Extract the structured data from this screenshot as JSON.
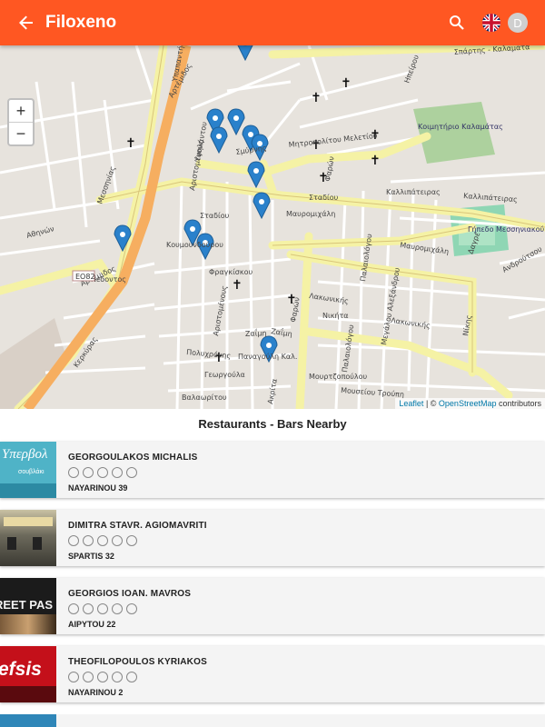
{
  "app": {
    "title": "Filoxeno",
    "avatar_letter": "D",
    "accent": "#ff5722"
  },
  "map": {
    "zoom_in": "+",
    "zoom_out": "−",
    "attribution": {
      "leaflet": "Leaflet",
      "sep": " | © ",
      "osm": "OpenStreetMap",
      "suffix": " contributors"
    },
    "labels": {
      "stadiou": "Σταδίου",
      "stadiou2": "Σταδίου",
      "mitropoliton": "Μητροπολίτου Μελετίου",
      "mavromichali": "Μαυρομιχάλη",
      "mavromichali2": "Μαυρομιχάλη",
      "lakonikis": "Λακωνικής",
      "lakonikis2": "Λακωνικής",
      "kallipateiras": "Καλλιπάτειρας",
      "kallipateiras2": "Καλλιπάτειρας",
      "sparti": "Σπάρτης - Καλαμάτα",
      "artemidos": "Αρτέμιδος",
      "artemidos2": "Αρτέμιδος",
      "athinon": "Αθηνών",
      "messinias": "Μεσσηνίας",
      "kerkyras": "Κερκύρας",
      "nedontos": "Νέδοντος",
      "faris": "Φαρών",
      "faris2": "Φαρών",
      "aristomenous": "Αριστομένους",
      "aristomenous2": "Αριστομένους",
      "koumoundourou": "Κουμουνδούρου",
      "zaimi": "Ζαΐμη",
      "zaimi2": "Ζαΐμη",
      "panagouli": "Παναγούλη Καλ.",
      "akrita": "Ακρίτα",
      "palaiologou": "Παλαιολόγου",
      "palaiologou2": "Παλαιολόγου",
      "mourtzoulou": "Μουρτζοπούλου",
      "polyxrous": "Πολυχρόνης",
      "georgoula": "Γεωργούλα",
      "valaoritou": "Βαλαωρίτου",
      "eo82": "ΕΟ82",
      "kimitirio": "Κοιμητήριο Καλαμάτας",
      "gipedo": "Γήπεδο Μεσσηνιακού",
      "nikita": "Νικήτα",
      "trioupi": "Μουσείου Τρούπη",
      "ypapantis": "Υπαπαντής",
      "fraggiskou": "Φραγκίσκου",
      "dagre": "Δαγρέ",
      "androutsou": "Ανδρούτσου",
      "alexandrou": "Μεγάλου Αλεξάνδρου",
      "nikis": "Νίκης",
      "ipirou": "Ηπείρου",
      "evmeneia": "Σμύρνης",
      "kapsali": "Υψηλάντου"
    }
  },
  "list": {
    "title": "Restaurants - Bars Nearby",
    "items": [
      {
        "name": "GEORGOULAKOS MICHALIS",
        "address": "NAYARINOU 39",
        "thumb_text": "Υπερβολ",
        "thumb_sub": "σουβλάκι"
      },
      {
        "name": "DIMITRA STAVR. AGIOMAVRITI",
        "address": "SPARTIS 32",
        "thumb_text": "",
        "thumb_sub": ""
      },
      {
        "name": "GEORGIOS IOAN. MAVROS",
        "address": "AIPYTOU 22",
        "thumb_text": "REET PAS",
        "thumb_sub": ""
      },
      {
        "name": "THEOFILOPOULOS KYRIAKOS",
        "address": "NAYARINOU 2",
        "thumb_text": "efsis",
        "thumb_sub": ""
      }
    ]
  }
}
